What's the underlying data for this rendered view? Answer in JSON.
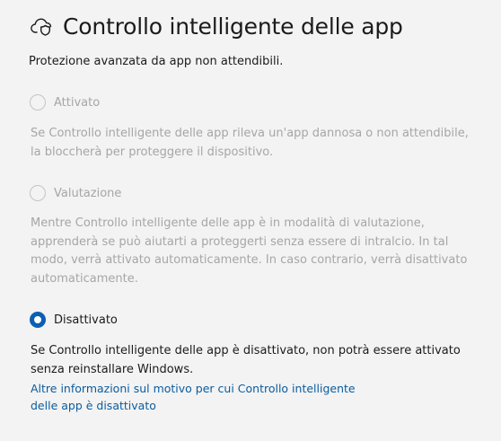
{
  "header": {
    "icon": "cloud-shield-icon",
    "title": "Controllo intelligente delle app"
  },
  "subtitle": "Protezione avanzata da app non attendibili.",
  "options": [
    {
      "label": "Attivato",
      "description": "Se Controllo intelligente delle app rileva un'app dannosa o non attendibile, la bloccherà per proteggere il dispositivo.",
      "selected": false,
      "enabled": false
    },
    {
      "label": "Valutazione",
      "description": "Mentre Controllo intelligente delle app è in modalità di valutazione, apprenderà se può aiutarti a proteggerti senza essere di intralcio. In tal modo, verrà attivato automaticamente. In caso contrario, verrà disattivato automaticamente.",
      "selected": false,
      "enabled": false
    },
    {
      "label": "Disattivato",
      "description": "Se Controllo intelligente delle app è disattivato, non potrà essere attivato senza reinstallare Windows.",
      "selected": true,
      "enabled": true
    }
  ],
  "link": {
    "text": "Altre informazioni sul motivo per cui Controllo intelligente delle app è disattivato"
  },
  "colors": {
    "accent": "#0a5fb3",
    "link": "#0a5c9e",
    "disabled_text": "#a6a6a6",
    "background": "#f3f3f3"
  }
}
